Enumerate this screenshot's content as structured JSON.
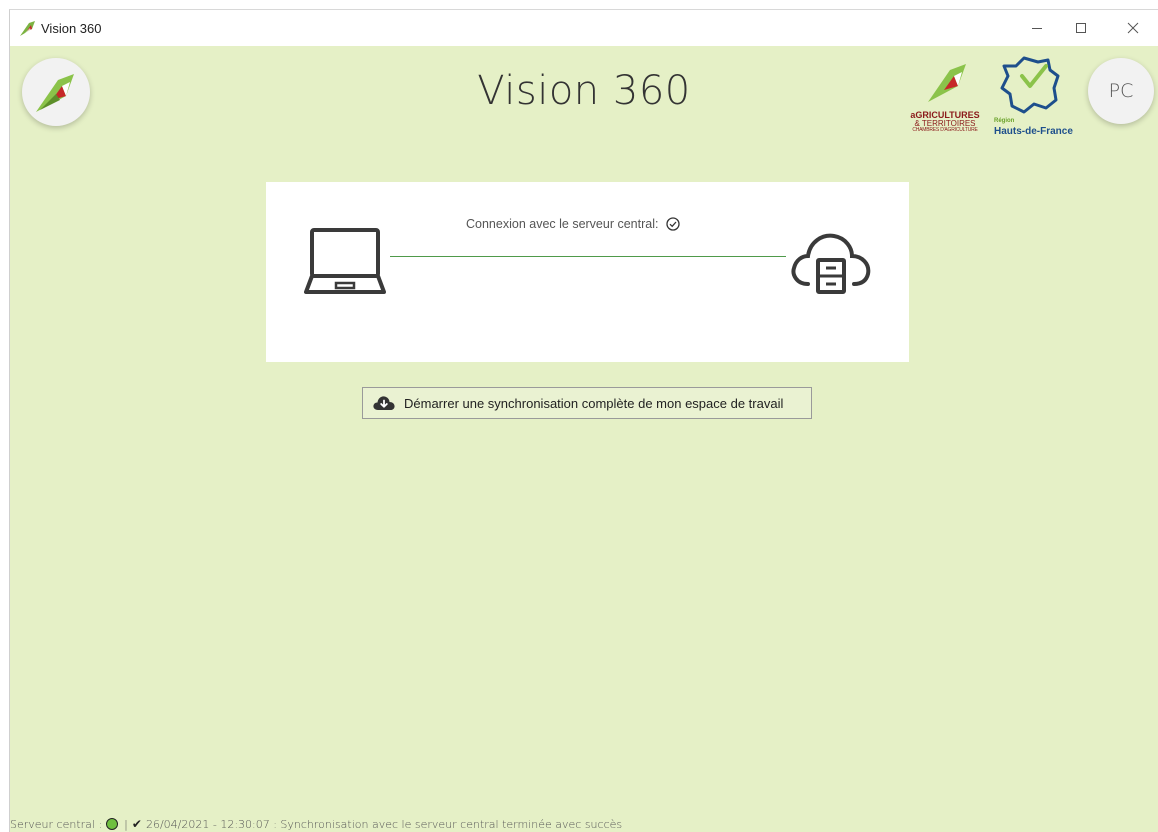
{
  "window": {
    "title": "Vision 360",
    "controls": {
      "minimize": "minimize-icon",
      "maximize": "maximize-icon",
      "close": "close-icon"
    }
  },
  "header": {
    "title": "Vision 360",
    "app_logo": "app-logo-icon",
    "partner_logo_1": {
      "line1": "aGRICULTURES",
      "line2": "& TERRITOIRES",
      "line3": "CHAMBRES D'AGRICULTURE"
    },
    "partner_logo_2": {
      "line1": "Région",
      "line2": "Hauts-de-France"
    },
    "user_initials": "PC"
  },
  "connection": {
    "label": "Connexion avec le serveur central:",
    "status_icon": "check-circle-icon",
    "line_color": "#4f9a4a"
  },
  "sync": {
    "button_label": "Démarrer une synchronisation complète de mon espace de travail",
    "icon": "cloud-download-icon"
  },
  "status_bar": {
    "prefix": "Serveur central :",
    "separator": "|",
    "check": "✔",
    "message": "26/04/2021 - 12:30:07 : Synchronisation avec le serveur central terminée avec succès",
    "indicator_color": "#6fbf3f"
  },
  "colors": {
    "background": "#e5f0c6",
    "accent": "#4f9a4a"
  }
}
